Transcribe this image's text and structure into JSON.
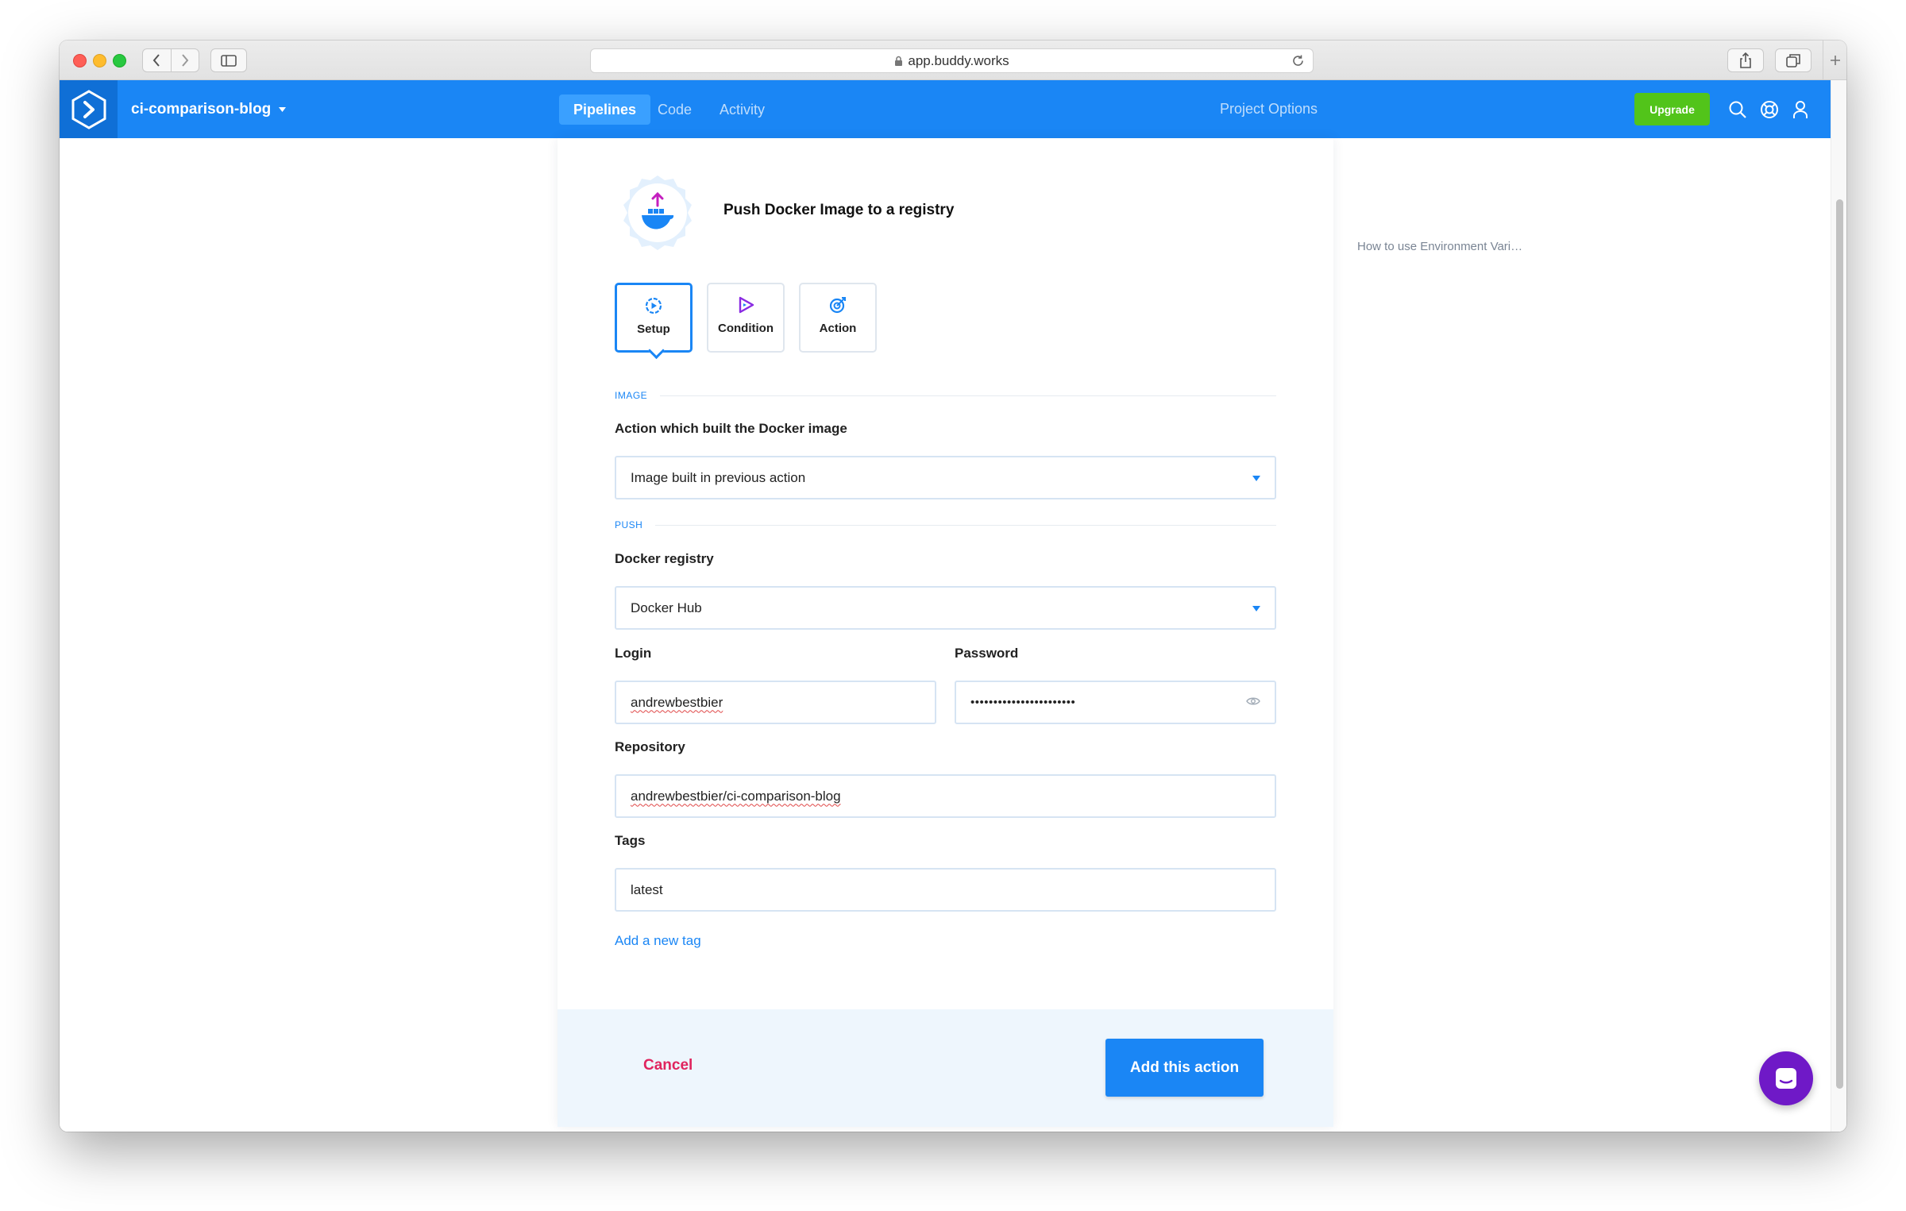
{
  "browser": {
    "url": "app.buddy.works"
  },
  "header": {
    "project_name": "ci-comparison-blog",
    "tabs": [
      {
        "label": "Pipelines"
      },
      {
        "label": "Code"
      },
      {
        "label": "Activity"
      }
    ],
    "project_options": "Project Options",
    "upgrade_label": "Upgrade"
  },
  "action": {
    "title": "Push Docker Image to a registry",
    "steps": [
      {
        "label": "Setup"
      },
      {
        "label": "Condition"
      },
      {
        "label": "Action"
      }
    ]
  },
  "form": {
    "section_image": "IMAGE",
    "image_action_label": "Action which built the Docker image",
    "image_action_value": "Image built in previous action",
    "section_push": "PUSH",
    "registry_label": "Docker registry",
    "registry_value": "Docker Hub",
    "login_label": "Login",
    "login_value": "andrewbestbier",
    "password_label": "Password",
    "password_value": "•••••••••••••••••••••••",
    "repository_label": "Repository",
    "repository_value": "andrewbestbier/ci-comparison-blog",
    "tags_label": "Tags",
    "tags_value": "latest",
    "add_tag_label": "Add a new tag"
  },
  "footer": {
    "cancel_label": "Cancel",
    "add_action_label": "Add this action"
  },
  "sidebar": {
    "help_link": "How to use Environment Vari…"
  },
  "colors": {
    "brand_blue": "#1a86f5",
    "upgrade_green": "#52c41a",
    "cancel_red": "#e0245e",
    "chat_purple": "#6f19c7"
  },
  "icons": [
    "lock-icon",
    "reload-icon",
    "logo-icon",
    "search-icon",
    "help-icon",
    "user-icon",
    "docker-push-icon",
    "setup-icon",
    "condition-icon",
    "action-icon",
    "eye-icon",
    "chat-icon"
  ]
}
